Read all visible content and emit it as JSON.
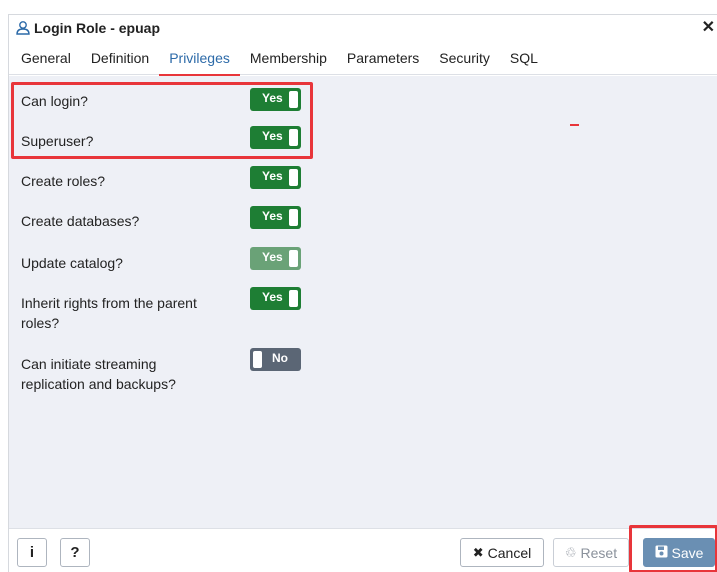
{
  "dialog": {
    "title": "Login Role - epuap",
    "close_symbol": "✕"
  },
  "tabs": [
    {
      "label": "General"
    },
    {
      "label": "Definition"
    },
    {
      "label": "Privileges",
      "active": true
    },
    {
      "label": "Membership"
    },
    {
      "label": "Parameters"
    },
    {
      "label": "Security"
    },
    {
      "label": "SQL"
    }
  ],
  "privileges": [
    {
      "label": "Can login?",
      "value": "Yes"
    },
    {
      "label": "Superuser?",
      "value": "Yes"
    },
    {
      "label": "Create roles?",
      "value": "Yes"
    },
    {
      "label": "Create databases?",
      "value": "Yes"
    },
    {
      "label": "Update catalog?",
      "value": "Yes",
      "disabled": true
    },
    {
      "label": "Inherit rights from the parent roles?",
      "value": "Yes"
    },
    {
      "label": "Can initiate streaming replication and backups?",
      "value": "No"
    }
  ],
  "footer": {
    "info_label": "i",
    "help_label": "?",
    "cancel_label": "Cancel",
    "reset_label": "Reset",
    "save_label": "Save"
  },
  "colors": {
    "accent": "#2c6aa8",
    "toggle_on": "#1e7e34",
    "toggle_off": "#5b6675",
    "highlight": "#e8353a",
    "save_button": "#6a8fb3"
  },
  "icons": {
    "title": "user-role-icon",
    "cancel": "x-icon",
    "reset": "recycle-icon",
    "save": "floppy-disk-icon"
  }
}
